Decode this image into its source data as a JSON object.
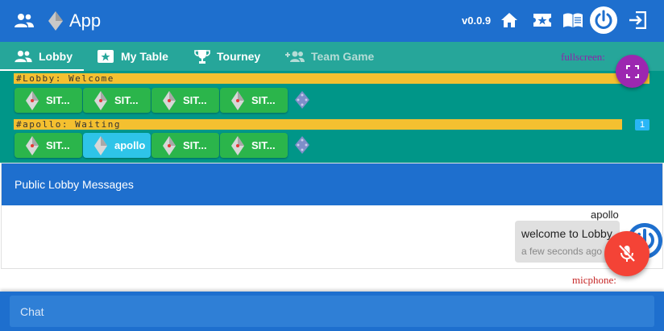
{
  "app": {
    "title": "App",
    "version": "v0.0.9"
  },
  "tabs": [
    {
      "label": "Lobby",
      "icon": "people-icon",
      "active": true
    },
    {
      "label": "My Table",
      "icon": "star-box-icon",
      "active": false
    },
    {
      "label": "Tourney",
      "icon": "trophy-icon",
      "active": false
    },
    {
      "label": "Team Game",
      "icon": "group-add-icon",
      "active": false,
      "disabled": true
    }
  ],
  "rooms": [
    {
      "name": "#Lobby: Welcome",
      "seats": [
        "SIT...",
        "SIT...",
        "SIT...",
        "SIT..."
      ],
      "count": ""
    },
    {
      "name": "#apollo: Waiting",
      "seats": [
        "SIT...",
        "apollo",
        "SIT...",
        "SIT..."
      ],
      "count": "1"
    }
  ],
  "fullscreen": {
    "label": "fullscreen:"
  },
  "messages": {
    "title": "Public Lobby Messages",
    "items": [
      {
        "sender": "apollo",
        "text": "welcome to Lobby",
        "time": "a few seconds ago"
      }
    ]
  },
  "microphone": {
    "label": "micphone:"
  },
  "chat": {
    "placeholder": "Chat"
  },
  "colors": {
    "primary": "#1e6fce",
    "tabs": "#26a69a",
    "lobby": "#009688",
    "seat": "#2bb54b",
    "seat_active": "#2ec4e8",
    "room_bar": "#f4c030",
    "fullscreen": "#9c27b0",
    "mic": "#f44336"
  }
}
